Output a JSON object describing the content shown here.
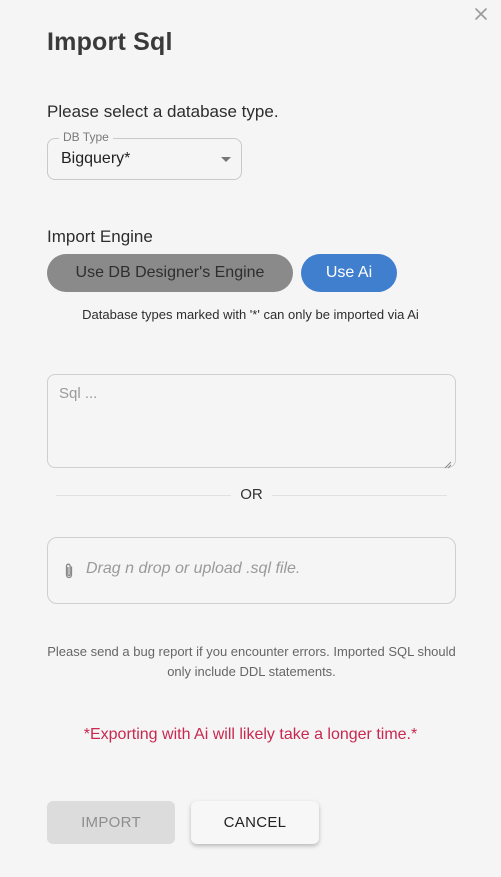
{
  "dialog": {
    "title": "Import Sql",
    "close_icon": "close-icon"
  },
  "db_type": {
    "prompt": "Please select a database type.",
    "legend": "DB Type",
    "selected_value": "Bigquery*",
    "caret_icon": "caret-down-icon"
  },
  "engine": {
    "label": "Import Engine",
    "db_designer_button": "Use DB Designer's Engine",
    "ai_button": "Use Ai",
    "note": "Database types marked with '*' can only be imported via Ai"
  },
  "sql_input": {
    "placeholder": "Sql ..."
  },
  "separator": {
    "text": "OR"
  },
  "upload": {
    "text": "Drag n drop or upload .sql file.",
    "icon": "paperclip-icon"
  },
  "bug_note": "Please send a bug report if you encounter errors. Imported SQL should only include DDL statements.",
  "warning": "*Exporting with Ai will likely take a longer time.*",
  "actions": {
    "import_label": "IMPORT",
    "cancel_label": "CANCEL"
  },
  "colors": {
    "ai_active": "#3f7fce",
    "engine_inactive": "#8a8a8a",
    "warning": "#c8284f",
    "background": "#f5f5f5"
  }
}
